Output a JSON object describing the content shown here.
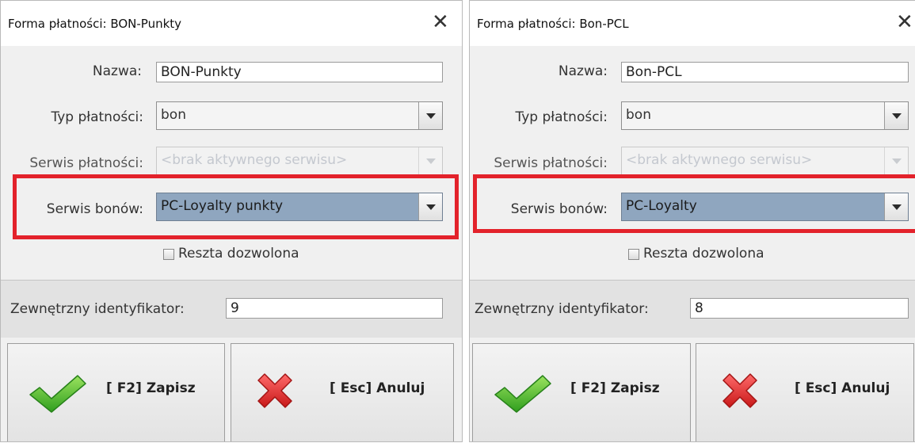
{
  "dialogs": [
    {
      "title": "Forma płatności: BON-Punkty",
      "close": "✕",
      "nazwa_label": "Nazwa:",
      "nazwa_value": "BON-Punkty",
      "typ_label": "Typ płatności:",
      "typ_value": "bon",
      "serwis_label": "Serwis płatności:",
      "serwis_value": "<brak aktywnego serwisu>",
      "bony_label": "Serwis bonów:",
      "bony_value": "PC-Loyalty punkty",
      "reszta_label": "Reszta dozwolona",
      "reszta_checked": false,
      "zewn_label": "Zewnętrzny identyfikator:",
      "zewn_value": "9",
      "save_label": "[ F2] Zapisz",
      "cancel_label": "[ Esc] Anuluj"
    },
    {
      "title": "Forma płatności: Bon-PCL",
      "close": "✕",
      "nazwa_label": "Nazwa:",
      "nazwa_value": "Bon-PCL",
      "typ_label": "Typ płatności:",
      "typ_value": "bon",
      "serwis_label": "Serwis płatności:",
      "serwis_value": "<brak aktywnego serwisu>",
      "bony_label": "Serwis bonów:",
      "bony_value": "PC-Loyalty",
      "reszta_label": "Reszta dozwolona",
      "reszta_checked": false,
      "zewn_label": "Zewnętrzny identyfikator:",
      "zewn_value": "8",
      "save_label": "[ F2] Zapisz",
      "cancel_label": "[ Esc] Anuluj"
    }
  ],
  "colors": {
    "highlight_border": "#e3222b",
    "selected_combo": "#8fa6bf",
    "check_icon": "#3fb52c",
    "cancel_icon": "#e02a2a"
  },
  "icons": {
    "save": "green-checkmark-icon",
    "cancel": "red-x-icon",
    "combo_arrow": "chevron-down-icon"
  }
}
